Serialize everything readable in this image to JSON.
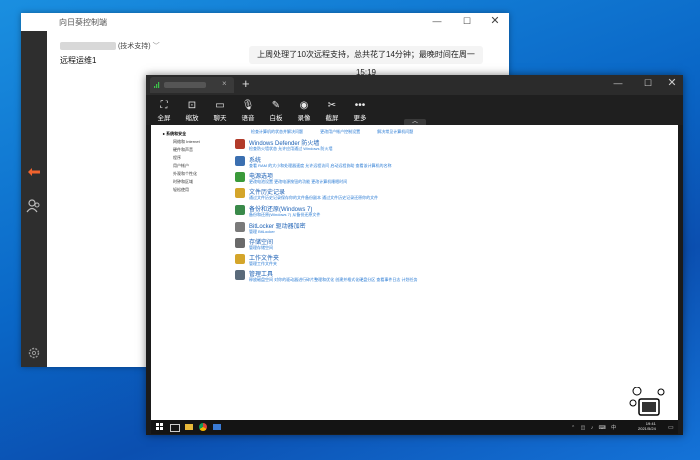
{
  "outer": {
    "title": "向日葵控制端",
    "account_suffix": "(技术支持)",
    "remote_name": "远程运维1",
    "notice": "上周处理了10次远程支持，总共花了14分钟；最晚时间在周一 15:19"
  },
  "inner": {
    "tab_close": "×",
    "tab_add": "+",
    "toolbar": [
      {
        "label": "全屏",
        "icon": "fullscreen-icon"
      },
      {
        "label": "缩放",
        "icon": "zoom-icon"
      },
      {
        "label": "聊天",
        "icon": "chat-icon"
      },
      {
        "label": "语音",
        "icon": "microphone-icon"
      },
      {
        "label": "白板",
        "icon": "whiteboard-icon"
      },
      {
        "label": "录像",
        "icon": "record-icon"
      },
      {
        "label": "截屏",
        "icon": "scissors-icon"
      },
      {
        "label": "更多",
        "icon": "more-icon"
      }
    ]
  },
  "control_panel": {
    "nav": [
      "系统和安全",
      "网络和 Internet",
      "硬件和声音",
      "程序",
      "用户帐户",
      "外观和个性化",
      "时钟和区域",
      "轻松使用"
    ],
    "top_links": [
      "检查计算机的状态并解决问题",
      "更改用户帐户控制设置",
      "解决常见计算机问题"
    ],
    "categories": [
      {
        "title": "Windows Defender 防火墙",
        "sub": "检查防火墙状态   允许应用通过 Windows 防火墙",
        "color": "#b23b2a"
      },
      {
        "title": "系统",
        "sub": "查看 RAM 的大小和处理器速度   允许远程访问   启动远程协助   查看该计算机的名称",
        "color": "#3b6fb0"
      },
      {
        "title": "电源选项",
        "sub": "更改电池设置   更改电源按钮的功能   更改计算机睡眠时间",
        "color": "#3a9a3a"
      },
      {
        "title": "文件历史记录",
        "sub": "通过文件历史记录保存你的文件备份副本   通过文件历史记录还原你的文件",
        "color": "#d4a52a"
      },
      {
        "title": "备份和还原(Windows 7)",
        "sub": "备份和还原(Windows 7)   从备份还原文件",
        "color": "#3a8a4a"
      },
      {
        "title": "BitLocker 驱动器加密",
        "sub": "管理 BitLocker",
        "color": "#7a7a7a"
      },
      {
        "title": "存储空间",
        "sub": "管理存储空间",
        "color": "#6a6a6a"
      },
      {
        "title": "工作文件夹",
        "sub": "管理工作文件夹",
        "color": "#d4a52a"
      },
      {
        "title": "管理工具",
        "sub": "释放磁盘空间   对你的驱动器进行碎片整理和优化   创建并格式化硬盘分区   查看事件日志   计划任务",
        "color": "#5a6a7a"
      }
    ]
  },
  "taskbar": {
    "time": "19:41",
    "date": "2021/5/24"
  },
  "colors": {
    "accent": "#1a5fb4",
    "toolbar_bg": "#1f1f1f",
    "sidebar_bg": "#2e2e2e"
  }
}
